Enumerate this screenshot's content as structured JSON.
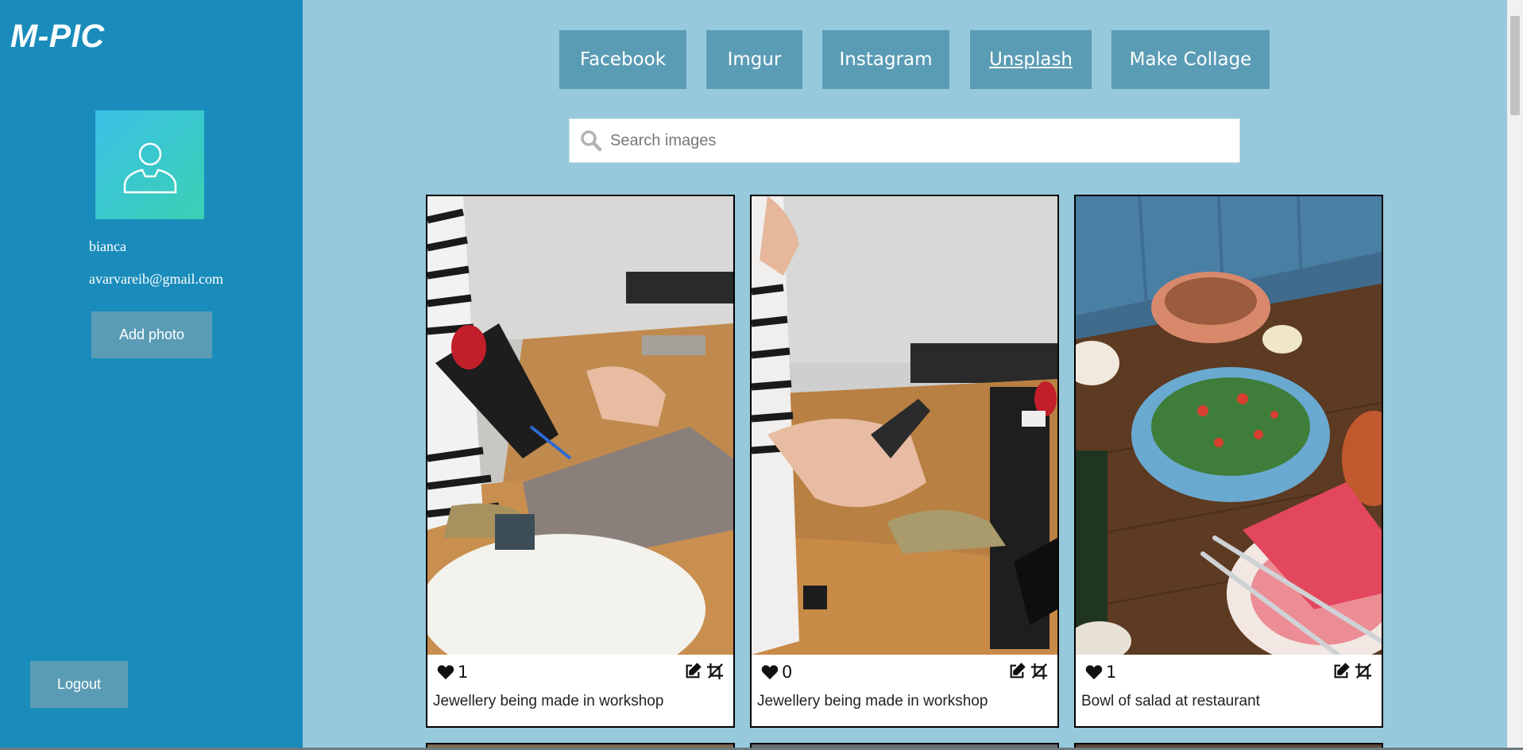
{
  "app": {
    "logo": "M-PIC"
  },
  "sidebar": {
    "avatar_icon": "user-outline-icon",
    "user_name": "bianca",
    "user_email": "avarvareib@gmail.com",
    "add_photo_label": "Add photo",
    "logout_label": "Logout"
  },
  "nav": {
    "items": [
      {
        "label": "Facebook"
      },
      {
        "label": "Imgur"
      },
      {
        "label": "Instagram"
      },
      {
        "label": "Unsplash",
        "active": true
      },
      {
        "label": "Make Collage"
      }
    ]
  },
  "search": {
    "placeholder": "Search images",
    "value": "",
    "icon": "search-icon"
  },
  "gallery": {
    "cards": [
      {
        "likes": "1",
        "caption": "Jewellery being made in workshop",
        "image": "jewellery-soldering-photo"
      },
      {
        "likes": "0",
        "caption": "Jewellery being made in workshop",
        "image": "jewellery-pliers-photo"
      },
      {
        "likes": "1",
        "caption": "Bowl of salad at restaurant",
        "image": "salad-restaurant-photo"
      }
    ]
  },
  "colors": {
    "sidebar_bg": "#1a8cbb",
    "main_bg": "#96c9dc",
    "button_bg": "#5b9cb5",
    "avatar_gradient_start": "#3ac1e6",
    "avatar_gradient_end": "#3bd0b3"
  }
}
